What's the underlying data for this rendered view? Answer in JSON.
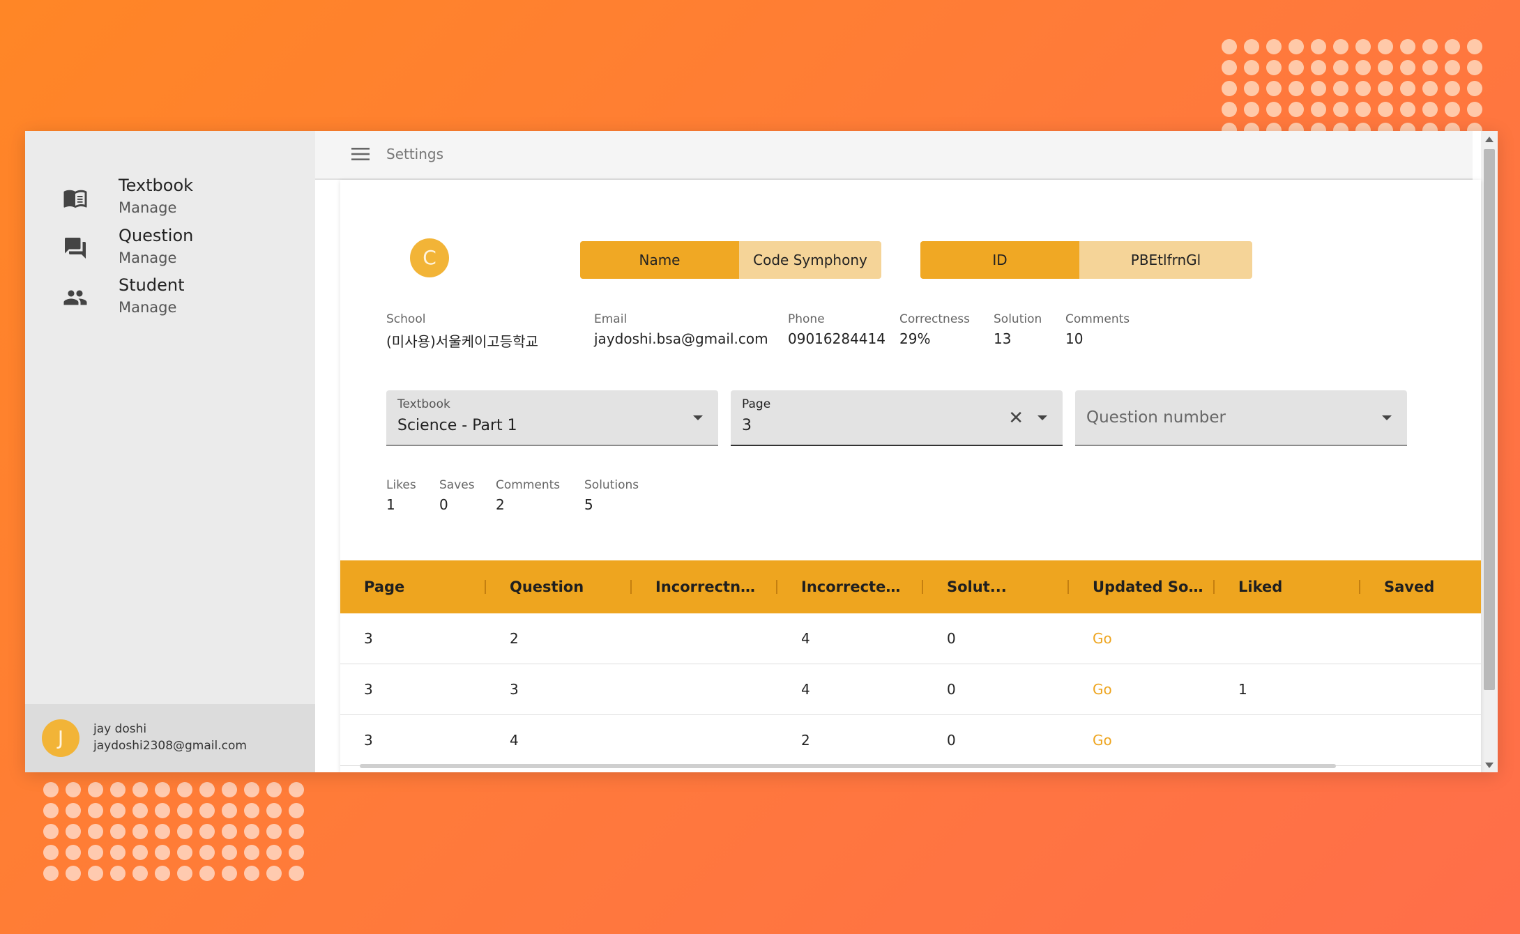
{
  "sidebar": {
    "items": [
      {
        "title": "Textbook",
        "subtitle": "Manage",
        "icon": "book-icon"
      },
      {
        "title": "Question",
        "subtitle": "Manage",
        "icon": "chat-icon"
      },
      {
        "title": "Student",
        "subtitle": "Manage",
        "icon": "people-icon"
      }
    ],
    "user": {
      "initial": "J",
      "name": "jay doshi",
      "email": "jaydoshi2308@gmail.com"
    }
  },
  "topbar": {
    "title": "Settings"
  },
  "profile": {
    "initial": "C",
    "name_label": "Name",
    "name_value": "Code Symphony",
    "id_label": "ID",
    "id_value": "PBEtlfrnGl"
  },
  "stats": [
    {
      "label": "School",
      "value": "(미사용)서울케이고등학교"
    },
    {
      "label": "Email",
      "value": "jaydoshi.bsa@gmail.com"
    },
    {
      "label": "Phone",
      "value": "09016284414"
    },
    {
      "label": "Correctness",
      "value": "29%"
    },
    {
      "label": "Solution",
      "value": "13"
    },
    {
      "label": "Comments",
      "value": "10"
    }
  ],
  "filters": {
    "textbook": {
      "label": "Textbook",
      "value": "Science - Part 1"
    },
    "page": {
      "label": "Page",
      "value": "3"
    },
    "question": {
      "placeholder": "Question number"
    }
  },
  "question_stats": [
    {
      "label": "Likes",
      "value": "1"
    },
    {
      "label": "Saves",
      "value": "0"
    },
    {
      "label": "Comments",
      "value": "2"
    },
    {
      "label": "Solutions",
      "value": "5"
    }
  ],
  "table": {
    "headers": [
      "Page",
      "Question",
      "Incorrectne...",
      "Incorrected ...",
      "Solut...",
      "Updated Sol...",
      "Liked",
      "Saved"
    ],
    "rows": [
      {
        "page": "3",
        "question": "2",
        "incorrectness": "",
        "incorrected": "4",
        "solutions": "0",
        "updated": "Go",
        "liked": "",
        "saved": ""
      },
      {
        "page": "3",
        "question": "3",
        "incorrectness": "",
        "incorrected": "4",
        "solutions": "0",
        "updated": "Go",
        "liked": "1",
        "saved": ""
      },
      {
        "page": "3",
        "question": "4",
        "incorrectness": "",
        "incorrected": "2",
        "solutions": "0",
        "updated": "Go",
        "liked": "",
        "saved": ""
      }
    ]
  },
  "colors": {
    "accent": "#eea51f",
    "accent_light": "#f5d498",
    "avatar": "#f2b437",
    "link": "#eea51f"
  }
}
